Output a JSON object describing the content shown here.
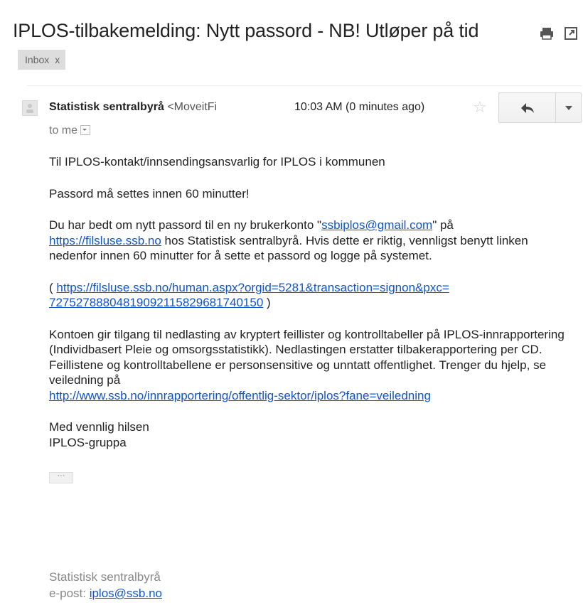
{
  "email": {
    "subject": "IPLOS-tilbakemelding: Nytt passord - NB! Utløper på tid",
    "label": "Inbox",
    "label_remove": "x",
    "sender_name": "Statistisk sentralbyrå",
    "sender_address": "<MoveitFi",
    "time": "10:03 AM (0 minutes ago)",
    "recipient": "to me",
    "icons": [
      "print-icon",
      "new-window-icon",
      "avatar-icon",
      "star-icon",
      "reply-icon",
      "chevron-down-icon"
    ]
  },
  "body": {
    "greeting": "Til IPLOS-kontakt/innsendingsansvarlig for IPLOS i kommunen",
    "warning": "Passord må settes innen 60 minutter!",
    "p1_a": "Du har bedt om nytt passord til en ny brukerkonto \"",
    "p1_email_link": "ssbiplos@gmail.com",
    "p1_b": "\" på",
    "p1_site_link": "https://filsluse.ssb.no",
    "p1_c": " hos Statistisk sentralbyrå. Hvis dette er riktig, vennligst benytt linken nedenfor innen 60 minutter for å sette et passord og logge på systemet.",
    "p2_open": "( ",
    "p2_link_line1": "https://filsluse.ssb.no/human.aspx?orgid=5281&transaction=signon&pxc=",
    "p2_link_line2": "72752788804819092115829681740150",
    "p2_close": " )",
    "p3": "Kontoen gir tilgang til nedlasting av kryptert feillister og kontrolltabeller på IPLOS-innrapportering (Individbasert Pleie og omsorgsstatistikk). Nedlastingen erstatter tilbakerapportering per CD. Feillistene og kontrolltabellene er personsensitive og unntatt offentlighet. Trenger du hjelp, se veiledning på",
    "p3_link": "http://www.ssb.no/innrapportering/offentlig-sektor/iplos?fane=veiledning",
    "closing_1": "Med vennlig hilsen",
    "closing_2": "IPLOS-gruppa",
    "ellipsis": "···"
  },
  "signature": {
    "org": "Statistisk sentralbyrå",
    "email_label": "e-post: ",
    "email_link": "iplos@ssb.no"
  }
}
